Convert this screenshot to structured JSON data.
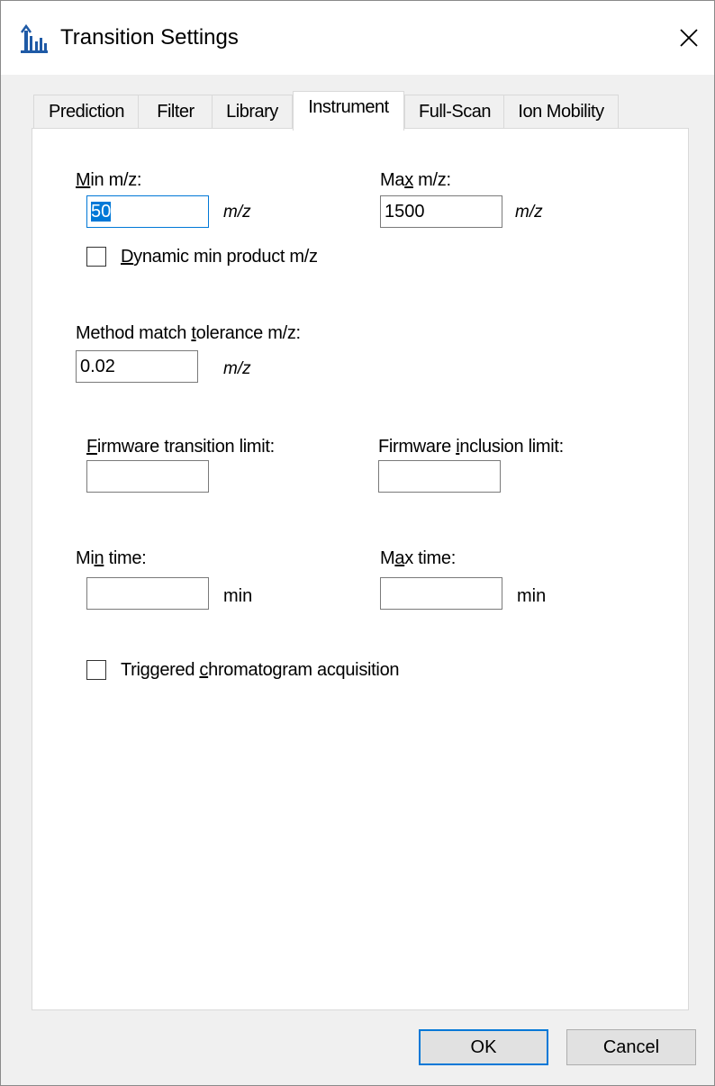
{
  "window": {
    "title": "Transition Settings",
    "icon": "skyline-chart-icon",
    "accent": "#0078d7"
  },
  "tabs": [
    {
      "label": "Prediction",
      "active": false
    },
    {
      "label": "Filter",
      "active": false
    },
    {
      "label": "Library",
      "active": false
    },
    {
      "label": "Instrument",
      "active": true
    },
    {
      "label": "Full-Scan",
      "active": false
    },
    {
      "label": "Ion Mobility",
      "active": false
    }
  ],
  "instrument": {
    "min_mz": {
      "mnemonic": "M",
      "rest": "in m/z:",
      "value": "50",
      "unit": "m/z"
    },
    "max_mz": {
      "pre": "Ma",
      "mnemonic": "x",
      "rest": " m/z:",
      "value": "1500",
      "unit": "m/z"
    },
    "dynamic_min": {
      "mnemonic": "D",
      "rest": "ynamic min product m/z",
      "checked": false
    },
    "method_tolerance": {
      "pre": "Method match ",
      "mnemonic": "t",
      "rest": "olerance m/z:",
      "value": "0.02",
      "unit": "m/z"
    },
    "firmware_transition": {
      "mnemonic": "F",
      "rest": "irmware transition limit:",
      "value": ""
    },
    "firmware_inclusion": {
      "pre": "Firmware ",
      "mnemonic": "i",
      "rest": "nclusion limit:",
      "value": ""
    },
    "min_time": {
      "pre": "Mi",
      "mnemonic": "n",
      "rest": " time:",
      "value": "",
      "unit": "min"
    },
    "max_time": {
      "pre": "M",
      "mnemonic": "a",
      "rest": "x time:",
      "value": "",
      "unit": "min"
    },
    "triggered": {
      "pre": "Triggered ",
      "mnemonic": "c",
      "rest": "hromatogram acquisition",
      "checked": false
    }
  },
  "buttons": {
    "ok": "OK",
    "cancel": "Cancel"
  }
}
